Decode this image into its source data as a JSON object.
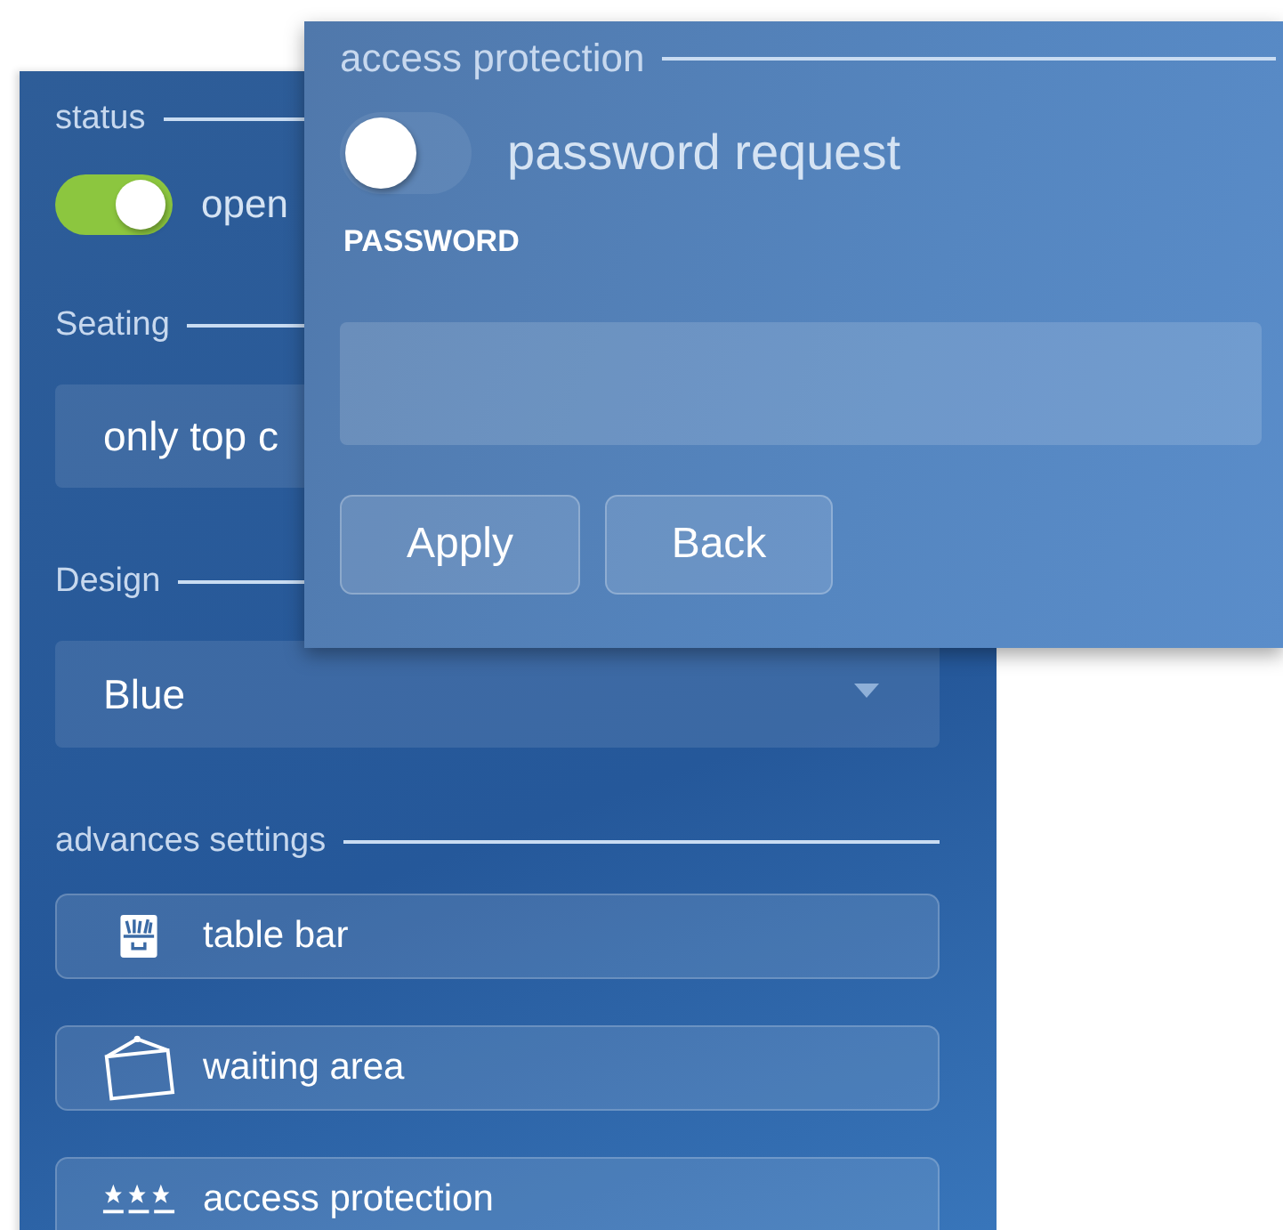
{
  "settings_panel": {
    "status": {
      "title": "status",
      "switch": {
        "on": true,
        "label": "open"
      }
    },
    "seating": {
      "title": "Seating",
      "value": "only top c"
    },
    "design": {
      "title": "Design",
      "value": "Blue"
    },
    "advanced": {
      "title": "advances settings",
      "items": [
        {
          "label": "table bar",
          "kind": "box"
        },
        {
          "label": "waiting area",
          "kind": "frame"
        },
        {
          "label": "access protection",
          "kind": "stars"
        }
      ]
    }
  },
  "dialog": {
    "title": "access protection",
    "switch": {
      "on": false,
      "label": "password request"
    },
    "field_label": "PASSWORD",
    "buttons": [
      "Apply",
      "Back"
    ]
  }
}
